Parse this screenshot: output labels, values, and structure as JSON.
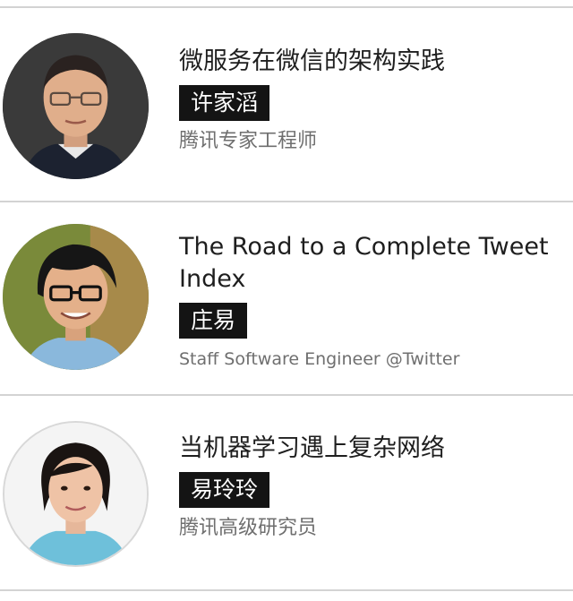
{
  "speakers": [
    {
      "title": "微服务在微信的架构实践",
      "name": "许家滔",
      "role": "腾讯专家工程师",
      "avatar_icon": "portrait-man-glasses-icon"
    },
    {
      "title": "The Road to a Complete Tweet Index",
      "name": "庄易",
      "role": "Staff Software Engineer @Twitter",
      "avatar_icon": "portrait-man-glasses-icon"
    },
    {
      "title": "当机器学习遇上复杂网络",
      "name": "易玲玲",
      "role": "腾讯高级研究员",
      "avatar_icon": "portrait-woman-icon"
    }
  ]
}
